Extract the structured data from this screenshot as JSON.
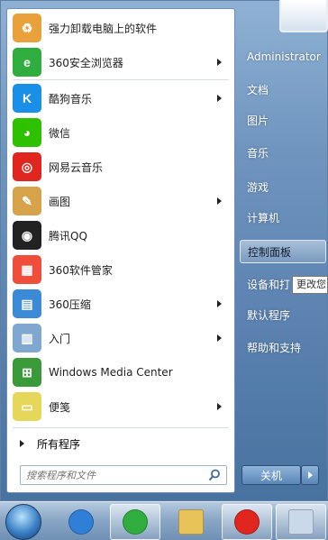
{
  "programs": [
    {
      "label": "强力卸载电脑上的软件",
      "icon": "uninstall-icon",
      "color": "#e9a23b",
      "glyph": "♻",
      "arrow": false
    },
    {
      "label": "360安全浏览器",
      "icon": "360-browser-icon",
      "color": "#2fae3f",
      "glyph": "e",
      "arrow": true
    },
    {
      "label": "酷狗音乐",
      "icon": "kugou-icon",
      "color": "#1a8fe8",
      "glyph": "K",
      "arrow": true
    },
    {
      "label": "微信",
      "icon": "wechat-icon",
      "color": "#2dc100",
      "glyph": "◕",
      "arrow": false
    },
    {
      "label": "网易云音乐",
      "icon": "netease-music-icon",
      "color": "#e0261e",
      "glyph": "◎",
      "arrow": false
    },
    {
      "label": "画图",
      "icon": "paint-icon",
      "color": "#d7a34a",
      "glyph": "✎",
      "arrow": true
    },
    {
      "label": "腾讯QQ",
      "icon": "qq-penguin-icon",
      "color": "#222222",
      "glyph": "◉",
      "arrow": false
    },
    {
      "label": "360软件管家",
      "icon": "360-software-manager-icon",
      "color": "#ef4f3a",
      "glyph": "▦",
      "arrow": false
    },
    {
      "label": "360压缩",
      "icon": "360-zip-icon",
      "color": "#3b8ad6",
      "glyph": "▤",
      "arrow": true
    },
    {
      "label": "入门",
      "icon": "getting-started-icon",
      "color": "#7fa7cf",
      "glyph": "▥",
      "arrow": true
    },
    {
      "label": "Windows Media Center",
      "icon": "windows-media-center-icon",
      "color": "#3a9a3a",
      "glyph": "⊞",
      "arrow": false
    },
    {
      "label": "便笺",
      "icon": "sticky-notes-icon",
      "color": "#e6d65a",
      "glyph": "▭",
      "arrow": true
    }
  ],
  "all_programs": "所有程序",
  "search": {
    "placeholder": "搜索程序和文件"
  },
  "right_items": [
    {
      "label": "Administrator",
      "highlight": false
    },
    {
      "label": "文档",
      "highlight": false
    },
    {
      "label": "图片",
      "highlight": false
    },
    {
      "label": "音乐",
      "highlight": false
    },
    {
      "label": "游戏",
      "highlight": false
    },
    {
      "label": "计算机",
      "highlight": false
    },
    {
      "label": "控制面板",
      "highlight": true
    },
    {
      "label": "设备和打",
      "highlight": false
    },
    {
      "label": "默认程序",
      "highlight": false
    },
    {
      "label": "帮助和支持",
      "highlight": false
    }
  ],
  "tooltip": "更改您",
  "shutdown": {
    "label": "关机"
  },
  "taskbar": [
    {
      "name": "taskbar-ie",
      "icon": "internet-explorer-icon",
      "open": false
    },
    {
      "name": "taskbar-360-browser",
      "icon": "360-browser-icon",
      "open": true
    },
    {
      "name": "taskbar-explorer",
      "icon": "folder-icon",
      "open": false
    },
    {
      "name": "taskbar-netease-music",
      "icon": "netease-music-icon",
      "open": true
    },
    {
      "name": "taskbar-other",
      "icon": "window-icon",
      "open": true
    }
  ]
}
